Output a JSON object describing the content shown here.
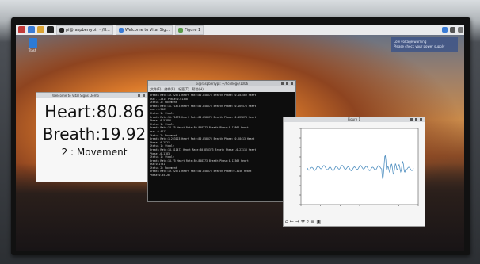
{
  "taskbar": {
    "window_buttons": [
      "pi@raspberrypi: ~/H...",
      "Welcome to Vital Sig...",
      "Figure 1"
    ]
  },
  "desktop": {
    "trash_label": "Trash"
  },
  "notification": {
    "line1": "Low voltage warning",
    "line2": "Please check your power supply"
  },
  "vital_window": {
    "title": "Welcome to Vital Signs Demo",
    "heart": "Heart:80.86",
    "breath": "Breath:19.92",
    "status": "2 : Movement"
  },
  "terminal": {
    "title": "pi@raspberrypi: ~/hcollege/1006",
    "menu": [
      "文件(F)",
      "编辑(E)",
      "标签(T)",
      "帮助(H)"
    ],
    "lines": [
      "Breath Rate:19.92571  Heart Rate:80.858373 Breath Phase:-0.103569 Heart",
      "ase:-1.2315 Phase:0.01368",
      "Status 2: Movement",
      "Breath Rate:11.71873  Heart Rate:80.858373 Breath Phase:-0.169578 Heart",
      "ase:-0.9563",
      "Status 1: Stable",
      "Breath Rate:11.71873  Heart Rate:80.858373 Breath Phase:-0.125674 Heart",
      "Phase:-0.51896",
      "Status 1: Stable",
      "Breath Rate:18.75  Heart Rate:80.858373 Breath Phase:0.13866 Heart",
      "ase:-0.4213",
      "Status 2: Movement",
      "Breath Rate:1.263123  Heart Rate:80.858373 Breath Phase:-0.28413 Heart",
      "Phase:-0.2521",
      "Status 1: Stable",
      "Breath Rate:18.811473  Heart Rate:80.858373 Breath Phase:-0.27118 Heart",
      "Phase:-0.1183",
      "Status 1: Stable",
      "Breath Rate:18.75  Heart Rate:80.858373 Breath Phase:0.12369 Heart",
      "ase:0.2731",
      "Status 2: Movement",
      "Breath Rate:19.92571  Heart Rate:80.858373 Breath Phase:0.3156 Heart",
      "Phase:0.35126"
    ]
  },
  "figure": {
    "title": "Figure 1",
    "toolbar_icons": [
      "home-icon",
      "back-icon",
      "forward-icon",
      "pan-icon",
      "zoom-icon",
      "configure-icon",
      "save-icon"
    ],
    "line_color": "#4f8fc0"
  }
}
